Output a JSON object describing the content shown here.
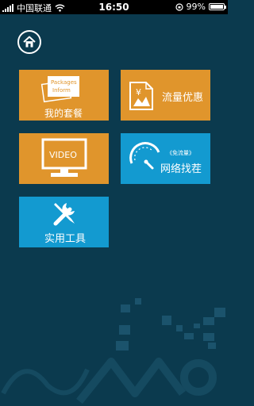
{
  "status": {
    "carrier": "中国联通",
    "time": "16:50",
    "battery": "99%",
    "battery_level": 0.99
  },
  "home": {
    "icon": "home-icon"
  },
  "tiles": [
    {
      "label": "我的套餐",
      "icon_text_1": "Packages",
      "icon_text_2": "Inform",
      "color": "#e0952c"
    },
    {
      "label": "流量优惠",
      "icon_text": "¥",
      "color": "#e0952c"
    },
    {
      "label": "",
      "icon_text": "VIDEO",
      "color": "#e0952c"
    },
    {
      "label": "网络找茬",
      "sub": "《免流量》",
      "color": "#139ad0"
    },
    {
      "label": "实用工具",
      "icon": "tools-icon",
      "color": "#139ad0"
    }
  ]
}
